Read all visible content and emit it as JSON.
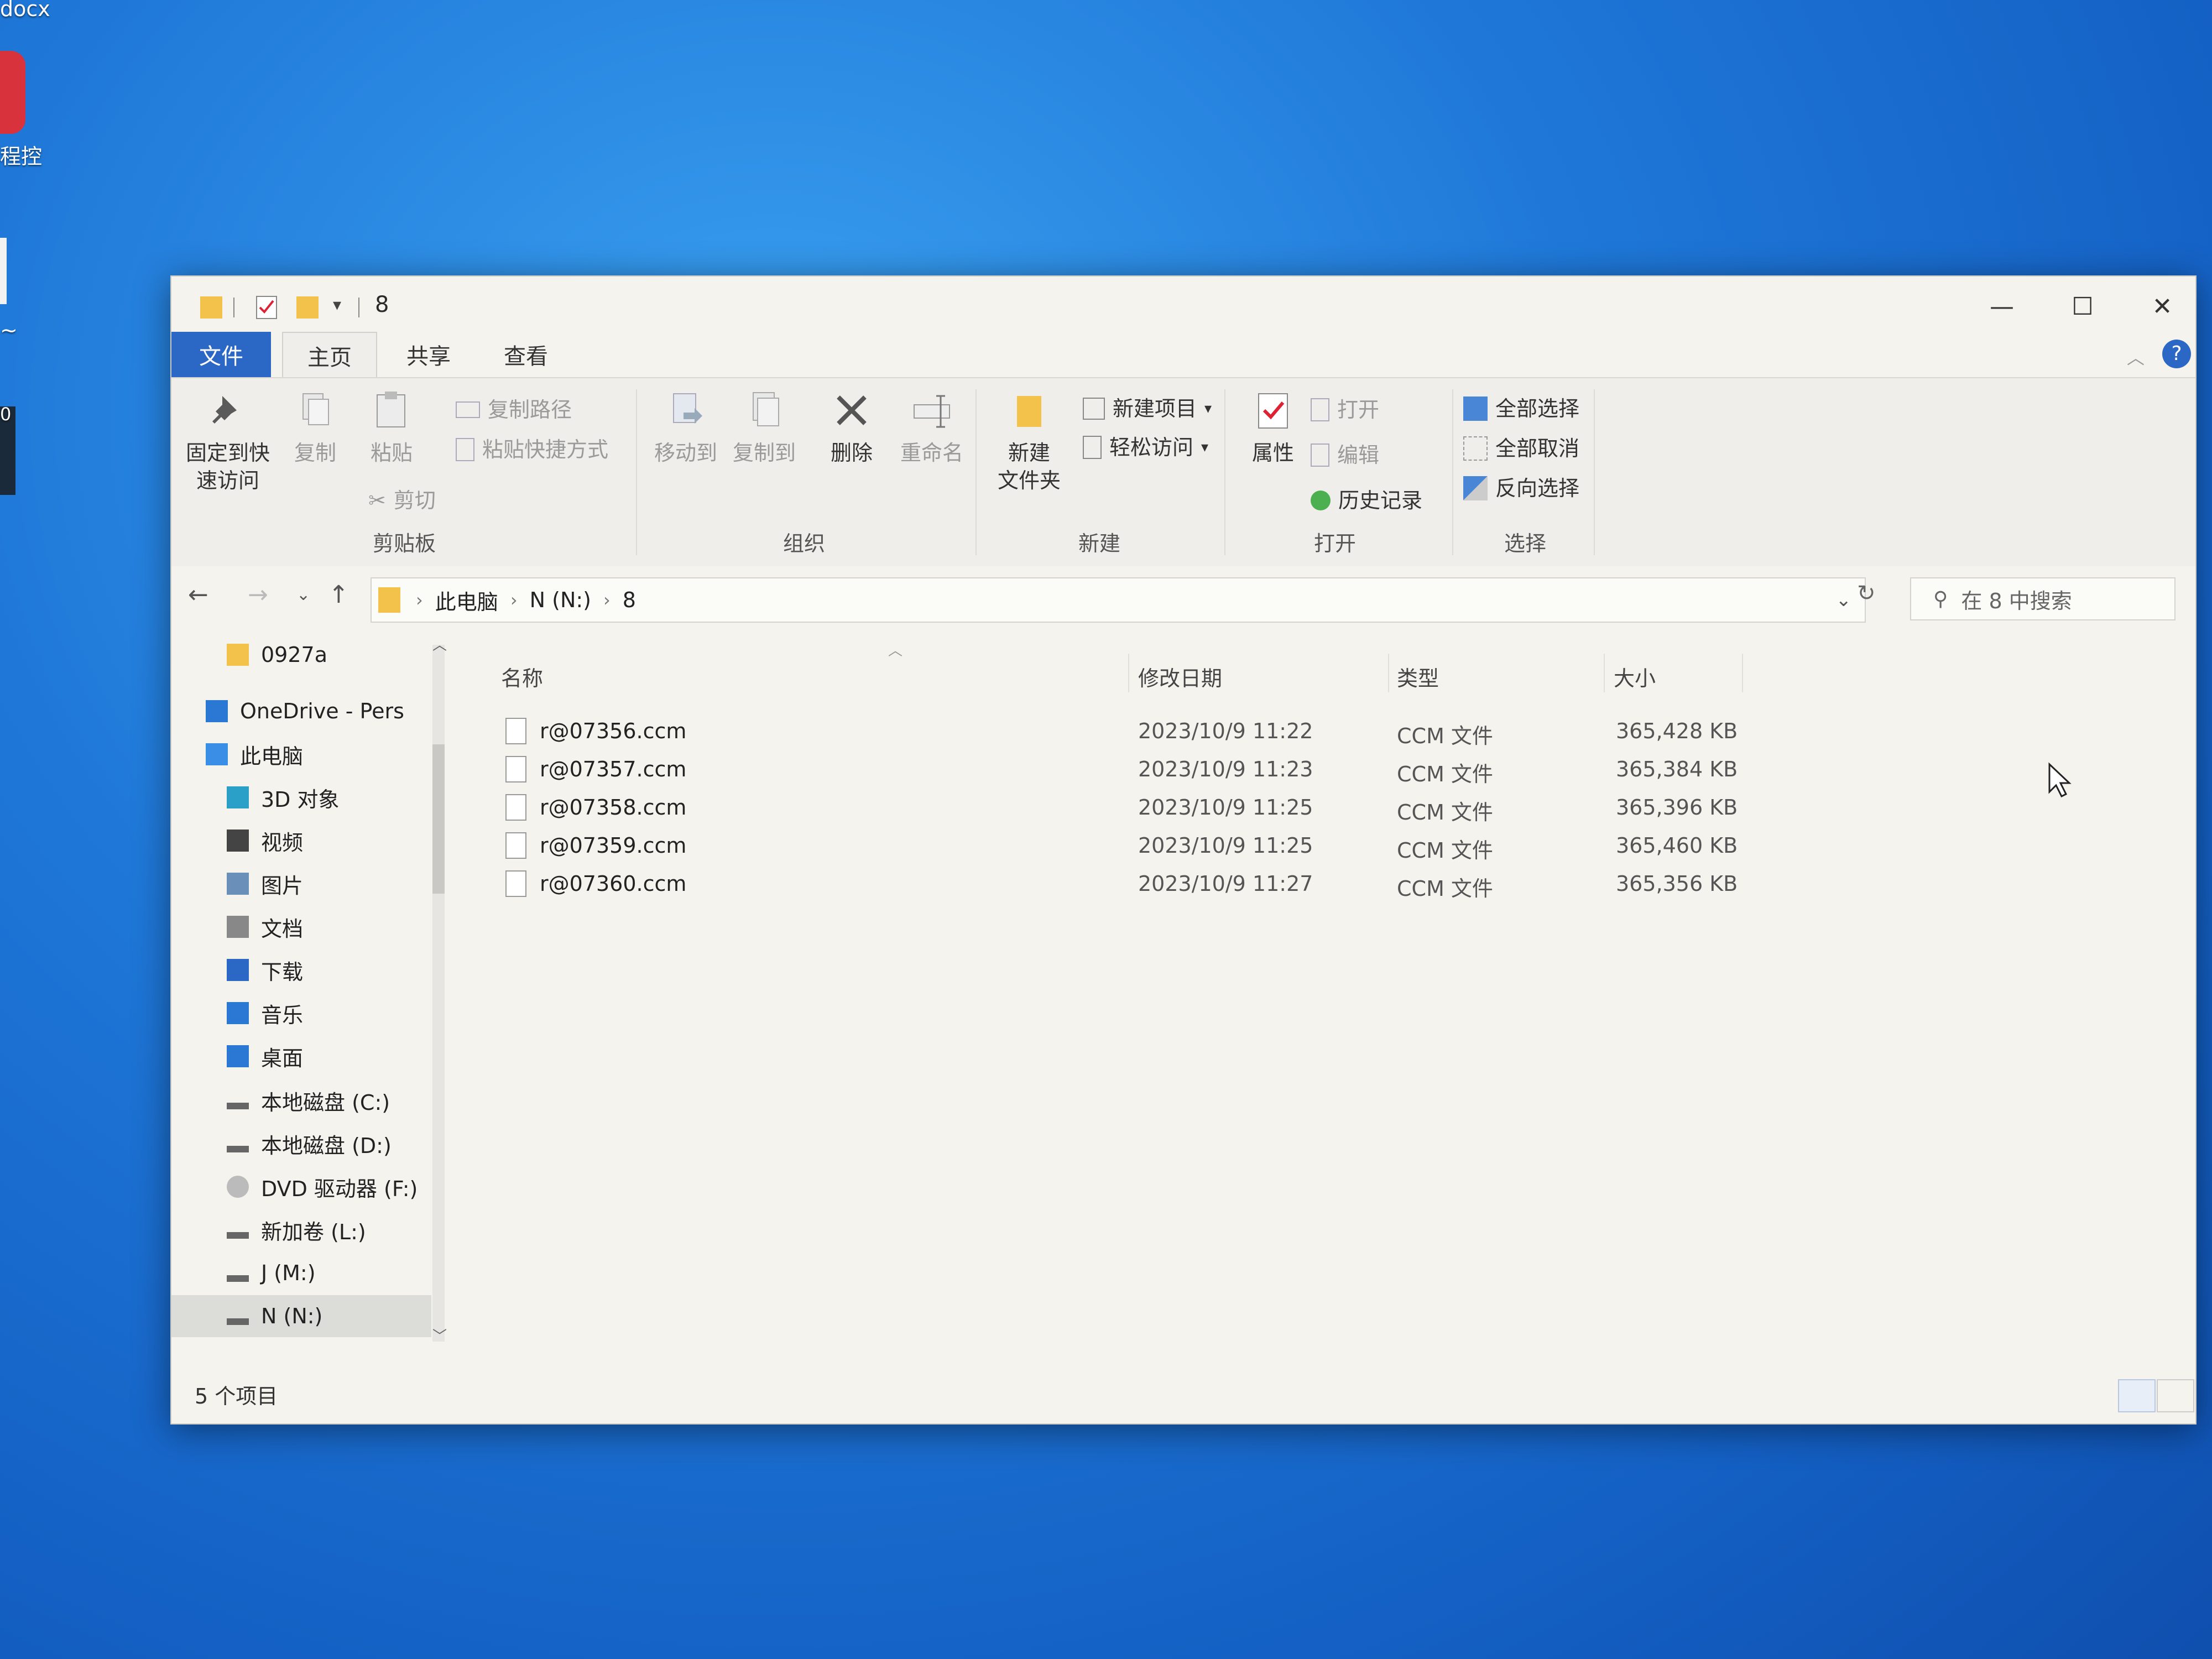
{
  "desktop": {
    "label_top": "docx",
    "label_mid": "程控",
    "label_tilde": "~",
    "label_zero": "0"
  },
  "window": {
    "title": "8",
    "controls": {
      "minimize": "—",
      "maximize": "☐",
      "close": "✕"
    }
  },
  "tabs": [
    "文件",
    "主页",
    "共享",
    "查看"
  ],
  "ribbon": {
    "clipboard": {
      "pin_line1": "固定到快",
      "pin_line2": "速访问",
      "copy": "复制",
      "paste": "粘贴",
      "copy_path": "复制路径",
      "paste_shortcut": "粘贴快捷方式",
      "cut": "剪切",
      "group": "剪贴板"
    },
    "organize": {
      "move_to": "移动到",
      "copy_to": "复制到",
      "delete": "删除",
      "rename": "重命名",
      "group": "组织"
    },
    "new": {
      "new_folder_line1": "新建",
      "new_folder_line2": "文件夹",
      "new_item": "新建项目",
      "easy_access": "轻松访问",
      "group": "新建"
    },
    "open": {
      "properties": "属性",
      "open": "打开",
      "edit": "编辑",
      "history": "历史记录",
      "group": "打开"
    },
    "select": {
      "select_all": "全部选择",
      "select_none": "全部取消",
      "invert": "反向选择",
      "group": "选择"
    }
  },
  "address": {
    "crumbs": [
      "此电脑",
      "N (N:)",
      "8"
    ],
    "search_placeholder": "在 8 中搜索"
  },
  "nav": [
    {
      "label": "0927a",
      "icon": "folder-icon"
    },
    {
      "label": "OneDrive - Pers",
      "icon": "cloud-icon"
    },
    {
      "label": "此电脑",
      "icon": "pc-icon"
    },
    {
      "label": "3D 对象",
      "icon": "cube-icon"
    },
    {
      "label": "视频",
      "icon": "video-icon"
    },
    {
      "label": "图片",
      "icon": "picture-icon"
    },
    {
      "label": "文档",
      "icon": "document-icon"
    },
    {
      "label": "下载",
      "icon": "download-icon"
    },
    {
      "label": "音乐",
      "icon": "music-icon"
    },
    {
      "label": "桌面",
      "icon": "desktop-icon"
    },
    {
      "label": "本地磁盘 (C:)",
      "icon": "drive-icon"
    },
    {
      "label": "本地磁盘 (D:)",
      "icon": "drive-icon"
    },
    {
      "label": "DVD 驱动器 (F:)",
      "icon": "dvd-icon"
    },
    {
      "label": "新加卷 (L:)",
      "icon": "drive-icon"
    },
    {
      "label": "J (M:)",
      "icon": "drive-icon"
    },
    {
      "label": "N (N:)",
      "icon": "drive-icon",
      "selected": true
    }
  ],
  "columns": {
    "name": "名称",
    "date": "修改日期",
    "type": "类型",
    "size": "大小"
  },
  "files": [
    {
      "name": "r@07356.ccm",
      "date": "2023/10/9 11:22",
      "type": "CCM 文件",
      "size": "365,428 KB"
    },
    {
      "name": "r@07357.ccm",
      "date": "2023/10/9 11:23",
      "type": "CCM 文件",
      "size": "365,384 KB"
    },
    {
      "name": "r@07358.ccm",
      "date": "2023/10/9 11:25",
      "type": "CCM 文件",
      "size": "365,396 KB"
    },
    {
      "name": "r@07359.ccm",
      "date": "2023/10/9 11:25",
      "type": "CCM 文件",
      "size": "365,460 KB"
    },
    {
      "name": "r@07360.ccm",
      "date": "2023/10/9 11:27",
      "type": "CCM 文件",
      "size": "365,356 KB"
    }
  ],
  "status": {
    "count": "5 个项目"
  },
  "colors": {
    "file_tab": "#2b67c4",
    "folder": "#f2c24a",
    "accent": "#2b67c4"
  }
}
